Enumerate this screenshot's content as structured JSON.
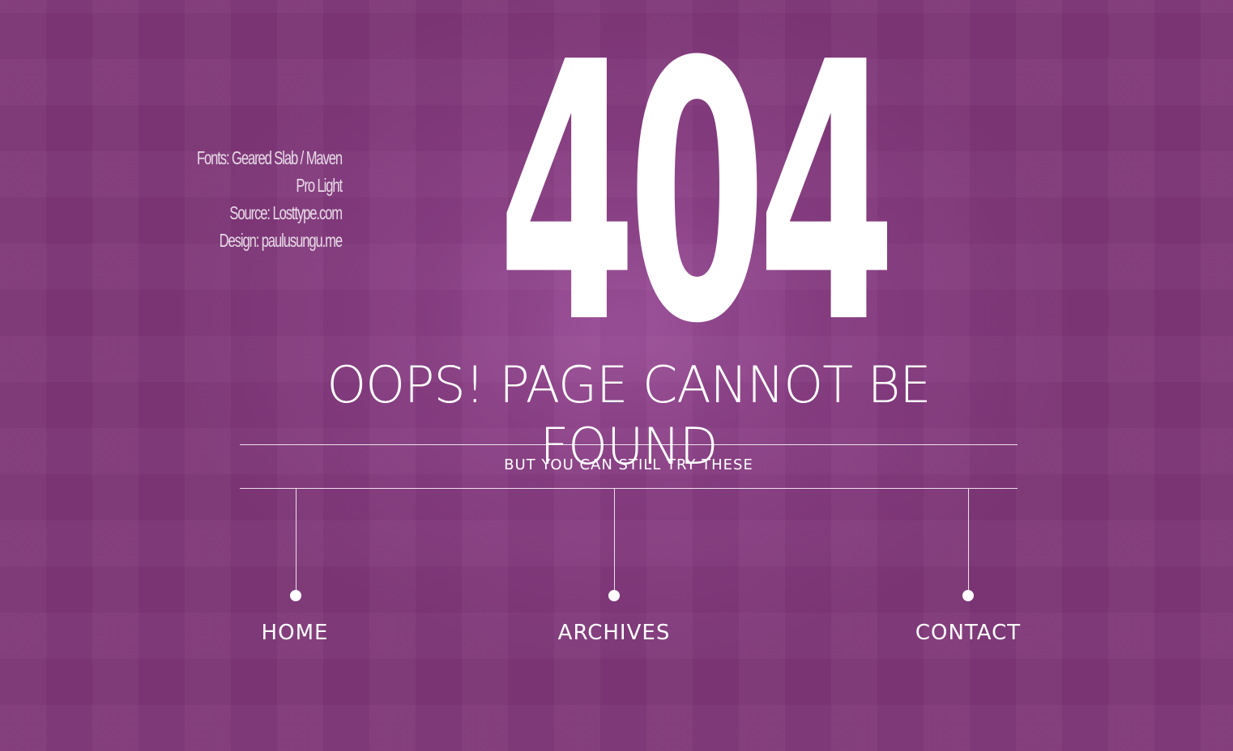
{
  "page": {
    "background_color": "#7e3677",
    "accent_color": "#ffffff"
  },
  "credits": {
    "fonts": "Fonts: Geared Slab / Maven Pro Light",
    "source": "Source: Losttype.com",
    "design": "Design: paulusungu.me"
  },
  "error": {
    "code": "404",
    "headline": "OOPS! PAGE CANNOT BE FOUND",
    "subline": "BUT YOU CAN STILL TRY THESE"
  },
  "nav": {
    "items": [
      {
        "label": "HOME",
        "icon": "dot-marker-icon"
      },
      {
        "label": "ARCHIVES",
        "icon": "dot-marker-icon"
      },
      {
        "label": "CONTACT",
        "icon": "dot-marker-icon"
      }
    ]
  }
}
